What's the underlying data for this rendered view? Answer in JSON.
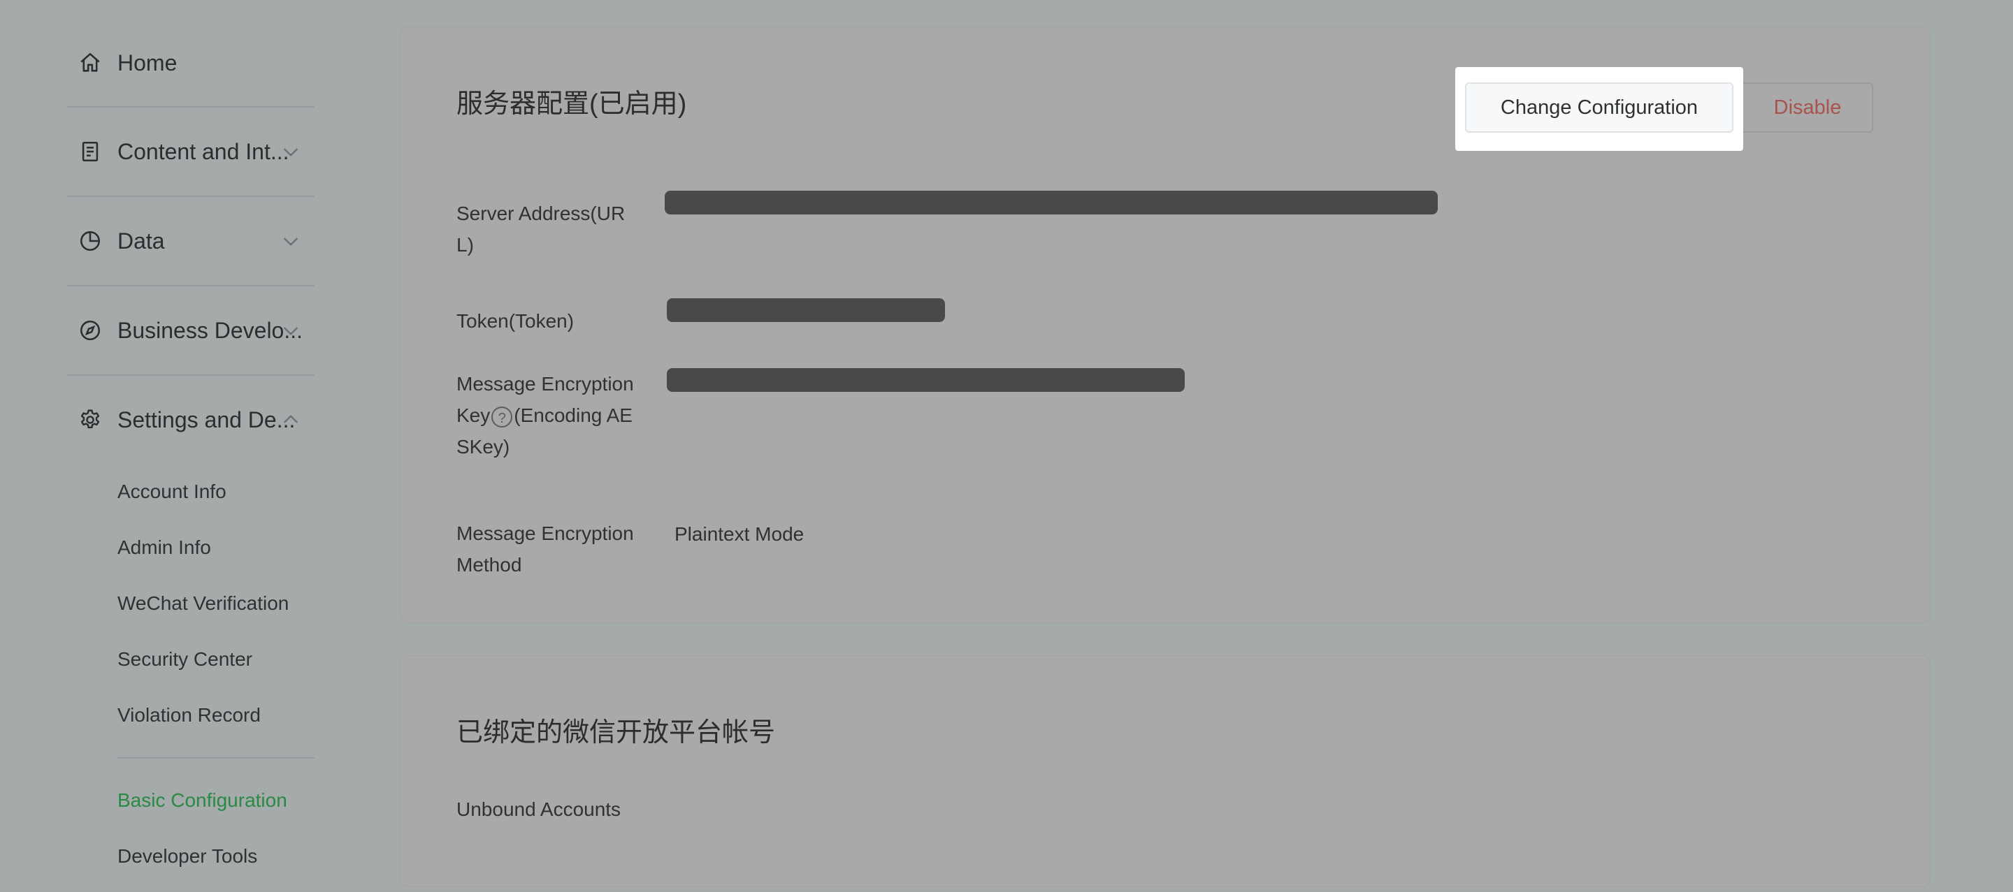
{
  "sidebar": {
    "home": {
      "label": "Home",
      "icon": "home-icon"
    },
    "groups": [
      {
        "label": "Content and Int...",
        "icon": "document-icon",
        "expanded": false
      },
      {
        "label": "Data",
        "icon": "pie-chart-icon",
        "expanded": false
      },
      {
        "label": "Business Develo...",
        "icon": "compass-icon",
        "expanded": false
      },
      {
        "label": "Settings and De...",
        "icon": "gear-icon",
        "expanded": true
      }
    ],
    "settings_items": [
      {
        "label": "Account Info"
      },
      {
        "label": "Admin Info"
      },
      {
        "label": "WeChat Verification"
      },
      {
        "label": "Security Center"
      },
      {
        "label": "Violation Record"
      }
    ],
    "dev_items": [
      {
        "label": "Basic Configuration",
        "active": true
      },
      {
        "label": "Developer Tools",
        "active": false
      }
    ],
    "active_color": "#2a8a44"
  },
  "server_config": {
    "title": "服务器配置(已启用)",
    "change_button": "Change Configuration",
    "disable_button": "Disable",
    "fields": {
      "url_label": "Server Address(URL)",
      "token_label": "Token(Token)",
      "aes_label_prefix": "Message Encryption Key",
      "aes_label_suffix": "(Encoding AESKey)",
      "aes_help_glyph": "?",
      "method_label": "Message Encryption Method",
      "method_value": "Plaintext Mode"
    }
  },
  "bound_accounts": {
    "title": "已绑定的微信开放平台帐号",
    "status": "Unbound Accounts"
  }
}
